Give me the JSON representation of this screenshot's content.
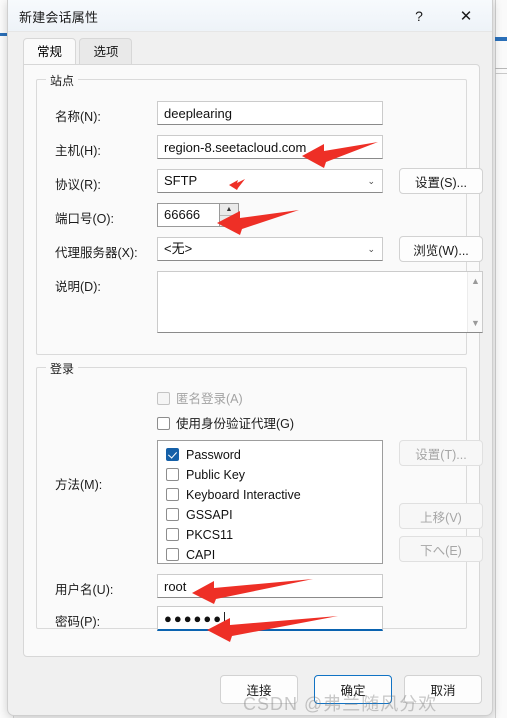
{
  "window": {
    "title": "新建会话属性",
    "help_label": "?",
    "close_label": "✕"
  },
  "tabs": [
    {
      "label": "常规",
      "active": true
    },
    {
      "label": "选项",
      "active": false
    }
  ],
  "site_group": {
    "legend": "站点",
    "name_label": "名称(N):",
    "name_value": "deeplearing",
    "host_label": "主机(H):",
    "host_value": "region-8.seetacloud.com",
    "protocol_label": "协议(R):",
    "protocol_value": "SFTP",
    "protocol_chevron": "⌄",
    "protocol_settings_button": "设置(S)...",
    "port_label": "端口号(O):",
    "port_value": "66666",
    "spin_up": "▲",
    "spin_down": "▼",
    "proxy_label": "代理服务器(X):",
    "proxy_value": "<无>",
    "proxy_chevron": "⌄",
    "proxy_browse_button": "浏览(W)...",
    "desc_label": "说明(D):",
    "desc_value": "",
    "scroll_up": "▲",
    "scroll_down": "▼"
  },
  "login_group": {
    "legend": "登录",
    "anonymous_label": "匿名登录(A)",
    "anonymous_checked": false,
    "anonymous_disabled": true,
    "agent_label": "使用身份验证代理(G)",
    "agent_checked": false,
    "method_label": "方法(M):",
    "methods": [
      {
        "label": "Password",
        "checked": true
      },
      {
        "label": "Public Key",
        "checked": false
      },
      {
        "label": "Keyboard Interactive",
        "checked": false
      },
      {
        "label": "GSSAPI",
        "checked": false
      },
      {
        "label": "PKCS11",
        "checked": false
      },
      {
        "label": "CAPI",
        "checked": false
      }
    ],
    "method_settings_button": "设置(T)...",
    "move_up_button": "上移(V)",
    "move_down_button": "下へ(E)",
    "username_label": "用户名(U):",
    "username_value": "root",
    "password_label": "密码(P):",
    "password_value": "●●●●●●"
  },
  "footer": {
    "connect_button": "连接",
    "ok_button": "确定",
    "cancel_button": "取消"
  },
  "watermark": "CSDN @弗兰随风分欢",
  "colors": {
    "accent": "#1560a8",
    "focus_underline": "#0a63b0",
    "annotation_arrow": "#ee2f26",
    "dialog_bg": "#f0f0f0"
  }
}
